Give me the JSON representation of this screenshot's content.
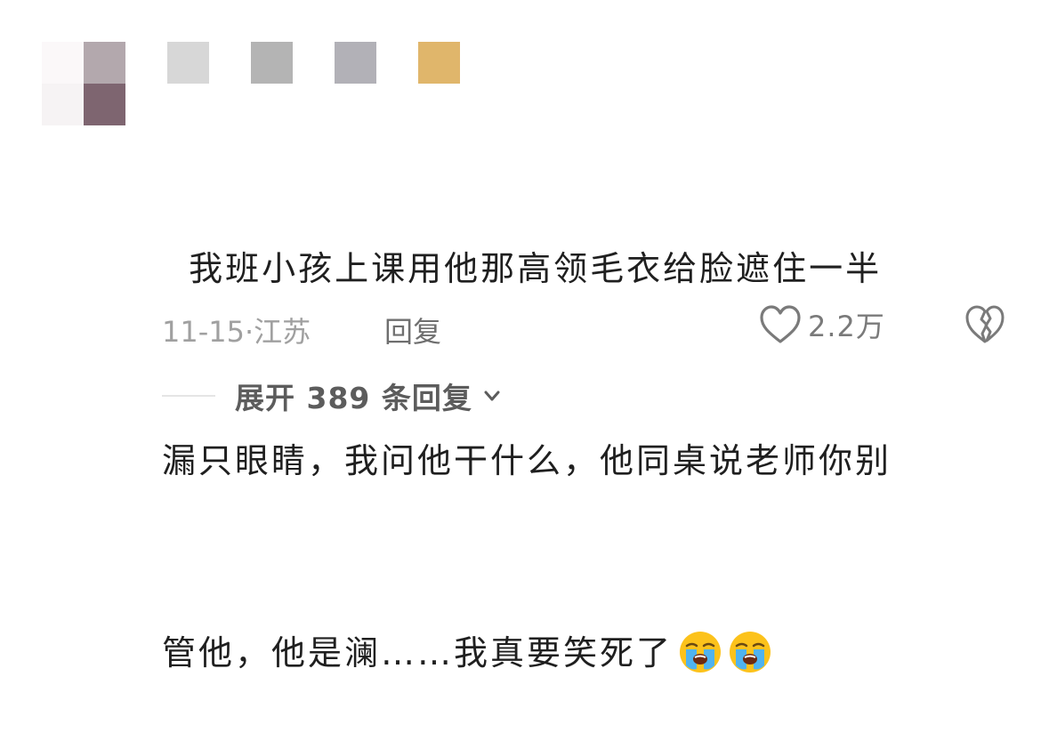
{
  "comment": {
    "content_lines": [
      "  我班小孩上课用他那高领毛衣给脸遮住一半",
      "漏只眼睛，我问他干什么，他同桌说老师你别",
      "管他，他是澜……我真要笑死了"
    ],
    "emoji_icons": [
      "loudly-crying-face-icon",
      "loudly-crying-face-icon"
    ],
    "date": "11-15",
    "location_separator": "·",
    "location": "江苏",
    "reply_label": "回复",
    "like_count": "2.2万",
    "expand_label": "展开 389 条回复"
  },
  "colors": {
    "avatar_pixels": [
      "#fbf8f9",
      "#b3a8ad",
      "#f6f3f4",
      "#7e6570"
    ],
    "name_pixels": [
      "#d7d7d7",
      "#b4b4b4",
      "#b2b1b7",
      "#e0b66b"
    ]
  }
}
